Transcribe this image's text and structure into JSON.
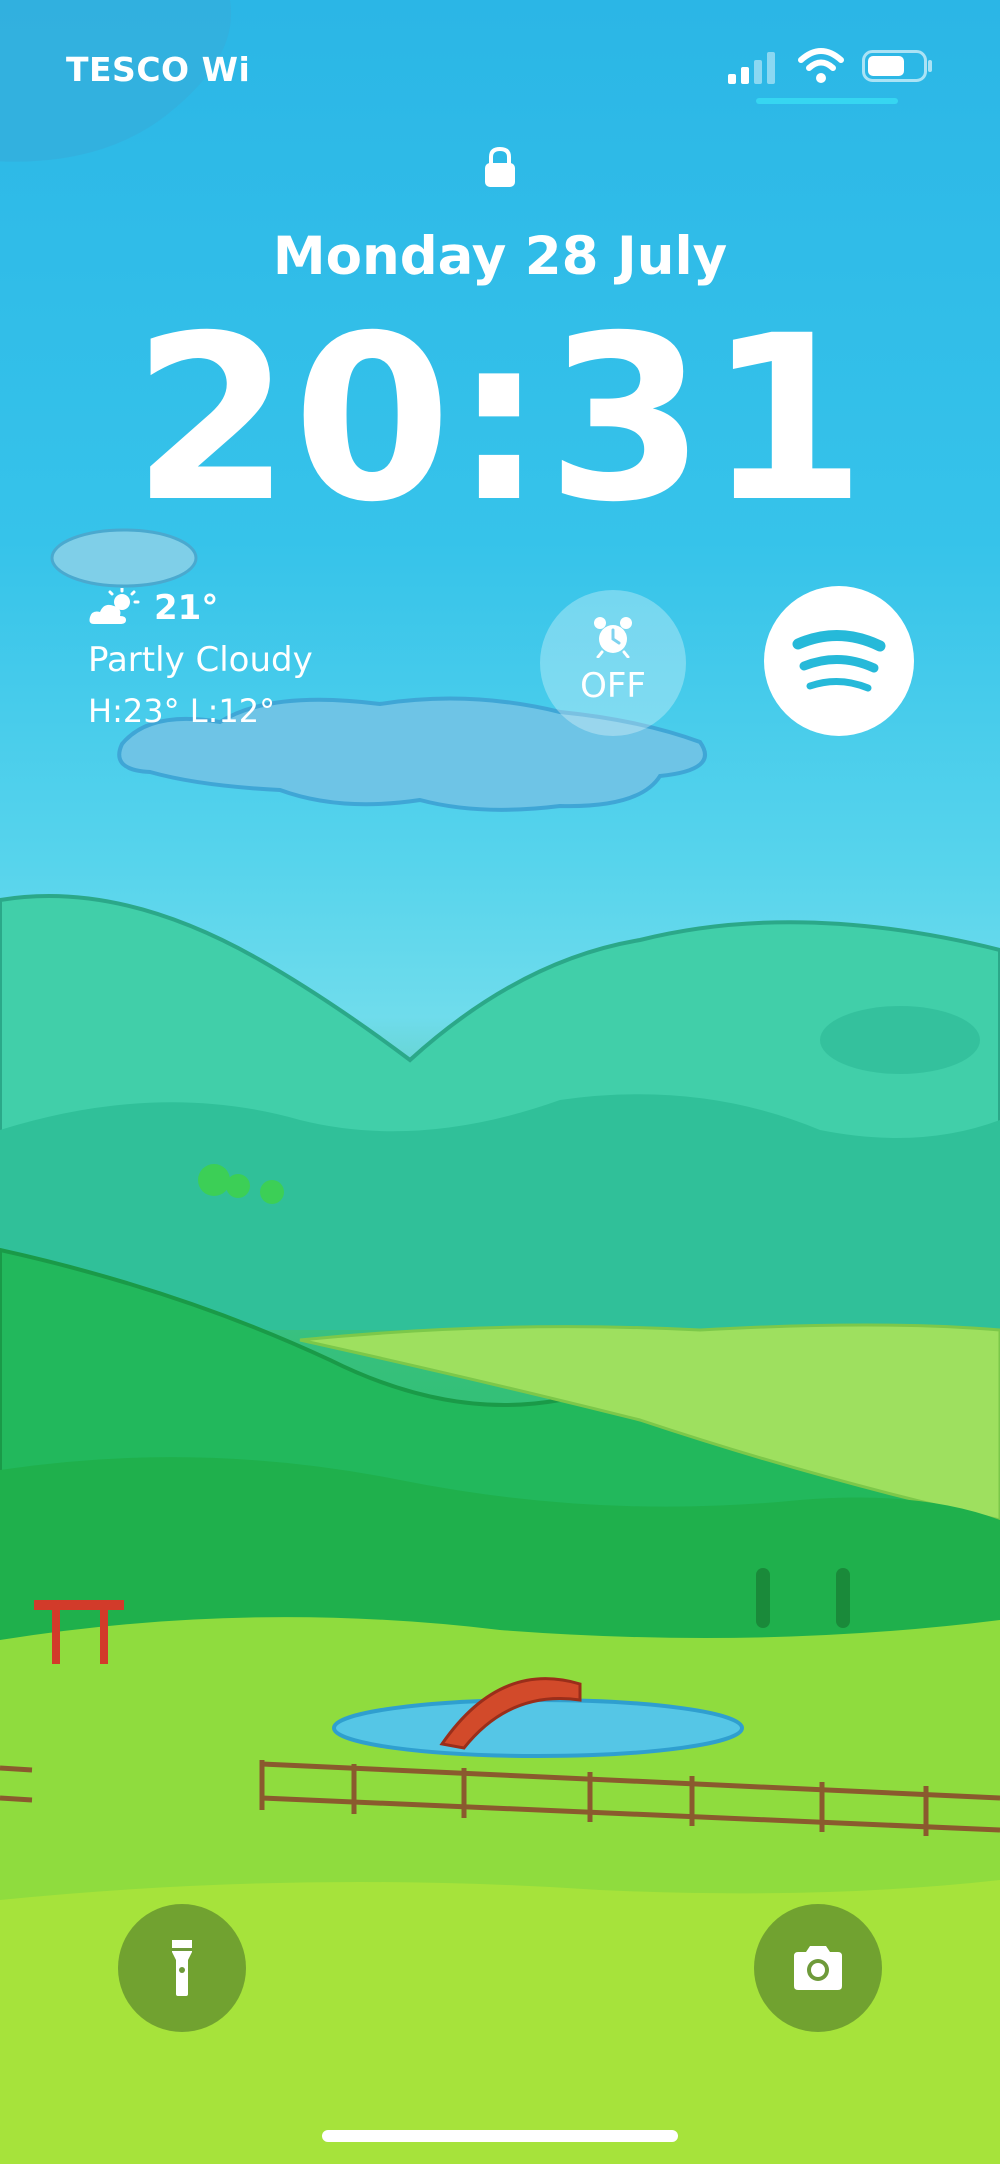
{
  "status_bar": {
    "carrier": "TESCO Wi",
    "signal_icon": "cellular-signal-icon",
    "wifi_icon": "wifi-icon",
    "battery_icon": "battery-icon"
  },
  "lock": {
    "icon": "lock-icon",
    "date": "Monday 28 July",
    "time": "20:31"
  },
  "weather_widget": {
    "icon": "partly-cloudy-icon",
    "temperature": "21°",
    "condition": "Partly Cloudy",
    "high_low": "H:23° L:12°"
  },
  "alarm_widget": {
    "icon": "alarm-clock-icon",
    "label": "OFF"
  },
  "spotify_widget": {
    "icon": "spotify-icon",
    "brand_color": "#1ed760"
  },
  "quick_actions": {
    "flashlight_icon": "flashlight-icon",
    "camera_icon": "camera-icon"
  },
  "colors": {
    "sky": "#2bb6e6",
    "hills": "#2ec06a",
    "meadow": "#a8e33a",
    "focus_accent": "#36d6f1"
  }
}
